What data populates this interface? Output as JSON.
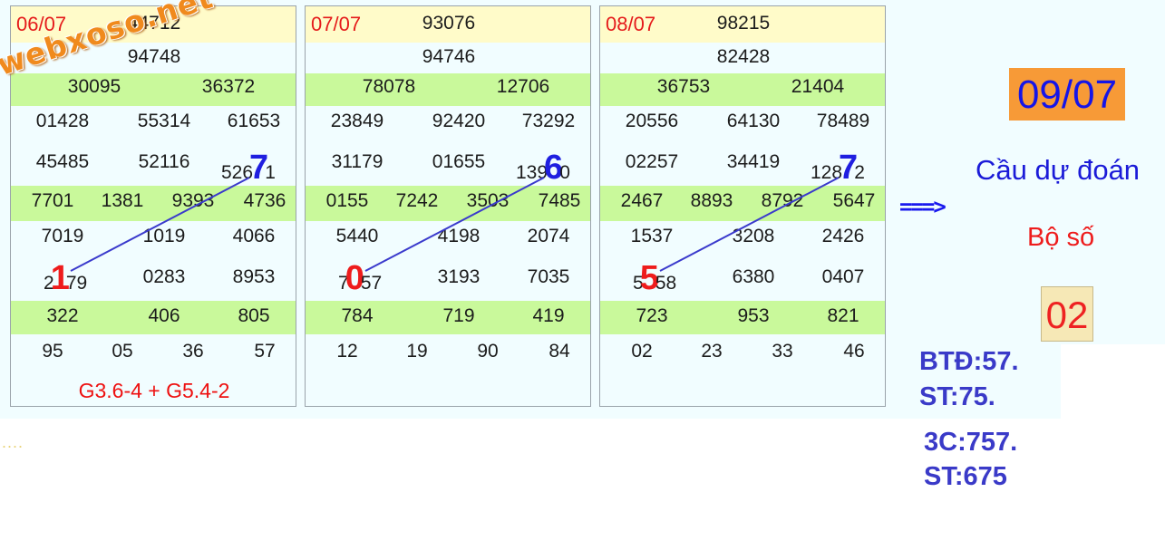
{
  "cards": [
    {
      "date": "06/07",
      "rows": [
        {
          "type": "yellow",
          "values": [
            "44712"
          ]
        },
        {
          "type": "plain",
          "values": [
            "94748"
          ]
        },
        {
          "type": "green",
          "values": [
            "30095",
            "36372"
          ]
        },
        {
          "type": "plain",
          "values": [
            "01428",
            "55314",
            "61653"
          ]
        },
        {
          "type": "plain",
          "values": [
            "45485",
            "52116",
            "52671"
          ]
        },
        {
          "type": "green",
          "values": [
            "7701",
            "1381",
            "9393",
            "4736"
          ]
        },
        {
          "type": "plain",
          "values": [
            "7019",
            "1019",
            "4066"
          ]
        },
        {
          "type": "plain",
          "values": [
            "2179",
            "0283",
            "8953"
          ]
        },
        {
          "type": "green",
          "values": [
            "322",
            "406",
            "805"
          ]
        },
        {
          "type": "plain",
          "values": [
            "95",
            "05",
            "36",
            "57"
          ]
        }
      ],
      "highlight_top": {
        "digit": "7",
        "prefix": "526",
        "suffix": "1"
      },
      "highlight_bottom": {
        "digit": "1",
        "prefix": "2",
        "suffix": "79"
      },
      "formula": "G3.6-4 + G5.4-2"
    },
    {
      "date": "07/07",
      "rows": [
        {
          "type": "yellow",
          "values": [
            "93076"
          ]
        },
        {
          "type": "plain",
          "values": [
            "94746"
          ]
        },
        {
          "type": "green",
          "values": [
            "78078",
            "12706"
          ]
        },
        {
          "type": "plain",
          "values": [
            "23849",
            "92420",
            "73292"
          ]
        },
        {
          "type": "plain",
          "values": [
            "31179",
            "01655",
            "13960"
          ]
        },
        {
          "type": "green",
          "values": [
            "0155",
            "7242",
            "3503",
            "7485"
          ]
        },
        {
          "type": "plain",
          "values": [
            "5440",
            "4198",
            "2074"
          ]
        },
        {
          "type": "plain",
          "values": [
            "7057",
            "3193",
            "7035"
          ]
        },
        {
          "type": "green",
          "values": [
            "784",
            "719",
            "419"
          ]
        },
        {
          "type": "plain",
          "values": [
            "12",
            "19",
            "90",
            "84"
          ]
        }
      ],
      "highlight_top": {
        "digit": "6",
        "prefix": "139",
        "suffix": "0"
      },
      "highlight_bottom": {
        "digit": "0",
        "prefix": "7",
        "suffix": "57"
      },
      "formula": ""
    },
    {
      "date": "08/07",
      "rows": [
        {
          "type": "yellow",
          "values": [
            "98215"
          ]
        },
        {
          "type": "plain",
          "values": [
            "82428"
          ]
        },
        {
          "type": "green",
          "values": [
            "36753",
            "21404"
          ]
        },
        {
          "type": "plain",
          "values": [
            "20556",
            "64130",
            "78489"
          ]
        },
        {
          "type": "plain",
          "values": [
            "02257",
            "34419",
            "12872"
          ]
        },
        {
          "type": "green",
          "values": [
            "2467",
            "8893",
            "8792",
            "5647"
          ]
        },
        {
          "type": "plain",
          "values": [
            "1537",
            "3208",
            "2426"
          ]
        },
        {
          "type": "plain",
          "values": [
            "5558",
            "6380",
            "0407"
          ]
        },
        {
          "type": "green",
          "values": [
            "723",
            "953",
            "821"
          ]
        },
        {
          "type": "plain",
          "values": [
            "02",
            "23",
            "33",
            "46"
          ]
        }
      ],
      "highlight_top": {
        "digit": "7",
        "prefix": "128",
        "suffix": "2"
      },
      "highlight_bottom": {
        "digit": "5",
        "prefix": "5",
        "suffix": "58"
      },
      "formula": ""
    }
  ],
  "prediction": {
    "arrow": "===>",
    "date": "09/07",
    "title": "Cầu dự đoán",
    "subtitle": "Bộ số",
    "number": "02",
    "btd": "BTĐ:57.",
    "st1": "ST:75.",
    "c3": "3C:757.",
    "st2": "ST:675"
  },
  "watermark": "webxoso.net",
  "dots": "....",
  "colors": {
    "yellow_row": "#fffbc9",
    "green_row": "#c9f99b",
    "date_red": "#e51b1b",
    "highlight_blue": "#1f1fe0",
    "highlight_red": "#ee1c1c",
    "link_line": "#3a3acc",
    "pred_date_bg": "#f79a37"
  }
}
